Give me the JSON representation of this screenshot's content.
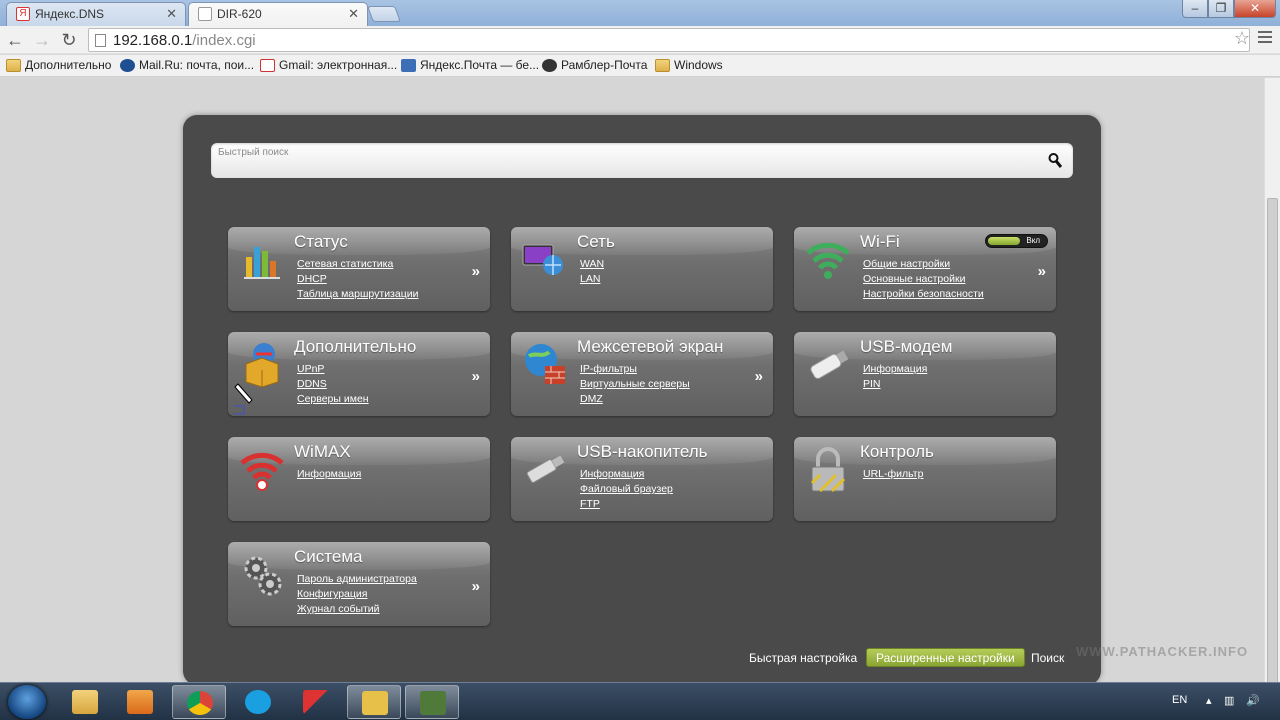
{
  "browser": {
    "tabs": [
      {
        "label": "Яндекс.DNS",
        "active": false
      },
      {
        "label": "DIR-620",
        "active": true
      }
    ],
    "url_host": "192.168.0.1",
    "url_path": "/index.cgi",
    "bookmarks": [
      {
        "label": "Дополнительно",
        "icon": "folder-icon"
      },
      {
        "label": "Mail.Ru: почта, пои...",
        "icon": "mailru-icon"
      },
      {
        "label": "Gmail: электронная...",
        "icon": "gmail-icon"
      },
      {
        "label": "Яндекс.Почта — бе...",
        "icon": "yandex-mail-icon"
      },
      {
        "label": "Рамблер-Почта",
        "icon": "rambler-icon"
      },
      {
        "label": "Windows",
        "icon": "folder-icon"
      }
    ]
  },
  "router": {
    "search_placeholder": "Быстрый поиск",
    "tiles": [
      {
        "title": "Статус",
        "icon": "status-chart-icon",
        "links": [
          "Сетевая статистика",
          "DHCP",
          "Таблица маршрутизации"
        ],
        "more": "»"
      },
      {
        "title": "Сеть",
        "icon": "network-icon",
        "links": [
          "WAN",
          "LAN"
        ],
        "more": ""
      },
      {
        "title": "Wi-Fi",
        "icon": "wifi-icon",
        "links": [
          "Общие настройки",
          "Основные настройки",
          "Настройки безопасности"
        ],
        "more": "»",
        "toggle_label": "Вкл"
      },
      {
        "title": "Дополнительно",
        "icon": "advanced-box-icon",
        "links": [
          "UPnP",
          "DDNS",
          "Серверы имен"
        ],
        "more": "»"
      },
      {
        "title": "Межсетевой экран",
        "icon": "firewall-icon",
        "links": [
          "IP-фильтры",
          "Виртуальные серверы",
          "DMZ"
        ],
        "more": "»"
      },
      {
        "title": "USB-модем",
        "icon": "usb-modem-icon",
        "links": [
          "Информация",
          "PIN"
        ],
        "more": ""
      },
      {
        "title": "WiMAX",
        "icon": "wimax-icon",
        "links": [
          "Информация"
        ],
        "more": ""
      },
      {
        "title": "USB-накопитель",
        "icon": "usb-storage-icon",
        "links": [
          "Информация",
          "Файловый браузер",
          "FTP"
        ],
        "more": ""
      },
      {
        "title": "Контроль",
        "icon": "lock-icon",
        "links": [
          "URL-фильтр"
        ],
        "more": ""
      },
      {
        "title": "Система",
        "icon": "gears-icon",
        "links": [
          "Пароль администратора",
          "Конфигурация",
          "Журнал событий"
        ],
        "more": "»"
      }
    ],
    "footer": {
      "quick_setup": "Быстрая настройка",
      "advanced": "Расширенные настройки",
      "search": "Поиск"
    },
    "watermark": "WWW.PATHACKER.INFO"
  },
  "taskbar": {
    "lang": "EN"
  },
  "colors": {
    "panel": "#4a4a4a",
    "accent_green": "#9ab83f"
  }
}
